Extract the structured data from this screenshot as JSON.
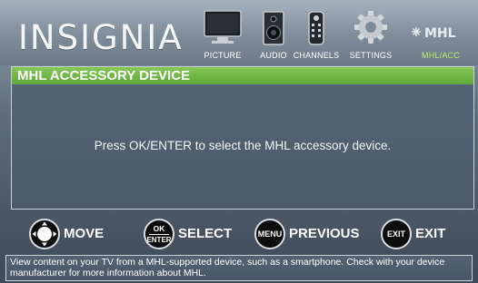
{
  "header": {
    "brand": "INSIGNIA",
    "menu": [
      {
        "label": "PICTURE",
        "icon": "tv-icon",
        "active": false
      },
      {
        "label": "AUDIO",
        "icon": "speaker-icon",
        "active": false
      },
      {
        "label": "CHANNELS",
        "icon": "remote-icon",
        "active": false
      },
      {
        "label": "SETTINGS",
        "icon": "gear-icon",
        "active": false
      },
      {
        "label": "MHL/ACC",
        "icon": "mhl-logo-icon",
        "active": true
      }
    ],
    "mhl_logo_text": "MHL"
  },
  "panel": {
    "title": "MHL ACCESSORY DEVICE",
    "message": "Press OK/ENTER to select the MHL accessory device."
  },
  "nav": {
    "move": {
      "label": "MOVE"
    },
    "select": {
      "label": "SELECT",
      "icon_top": "OK",
      "icon_bottom": "ENTER"
    },
    "previous": {
      "label": "PREVIOUS",
      "icon": "MENU"
    },
    "exit": {
      "label": "EXIT",
      "icon": "EXIT"
    }
  },
  "help_text": "View content on your TV from a MHL-supported device, such as a smartphone. Check with your device manufacturer for more information about MHL.",
  "colors": {
    "accent_green": "#6fb845",
    "active_label": "#b7ee6a",
    "panel_bg": "#4f5d6d"
  }
}
